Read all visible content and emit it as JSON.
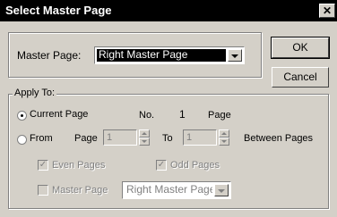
{
  "window": {
    "title": "Select Master Page",
    "close_symbol": "✕"
  },
  "master": {
    "label": "Master Page:",
    "selected": "Right Master Page"
  },
  "buttons": {
    "ok": "OK",
    "cancel": "Cancel"
  },
  "apply_to": {
    "legend": "Apply To:",
    "current_page_label": "Current Page",
    "no_label": "No.",
    "current_number": "1",
    "page_label": "Page",
    "from_label": "From",
    "from_page_label": "Page",
    "from_value": "1",
    "to_label": "To",
    "to_value": "1",
    "between_label": "Between Pages",
    "even_pages_label": "Even Pages",
    "odd_pages_label": "Odd Pages",
    "master_page_check_label": "Master Page",
    "master_page_select_value": "Right Master Page"
  },
  "icons": {
    "close": "close-icon",
    "dropdown": "chevron-down-icon",
    "spin_up": "arrow-up-icon",
    "spin_down": "arrow-down-icon",
    "check": "checkmark-icon"
  },
  "colors": {
    "titlebar": "#000000",
    "face": "#d4d0c8",
    "selection": "#000000"
  }
}
